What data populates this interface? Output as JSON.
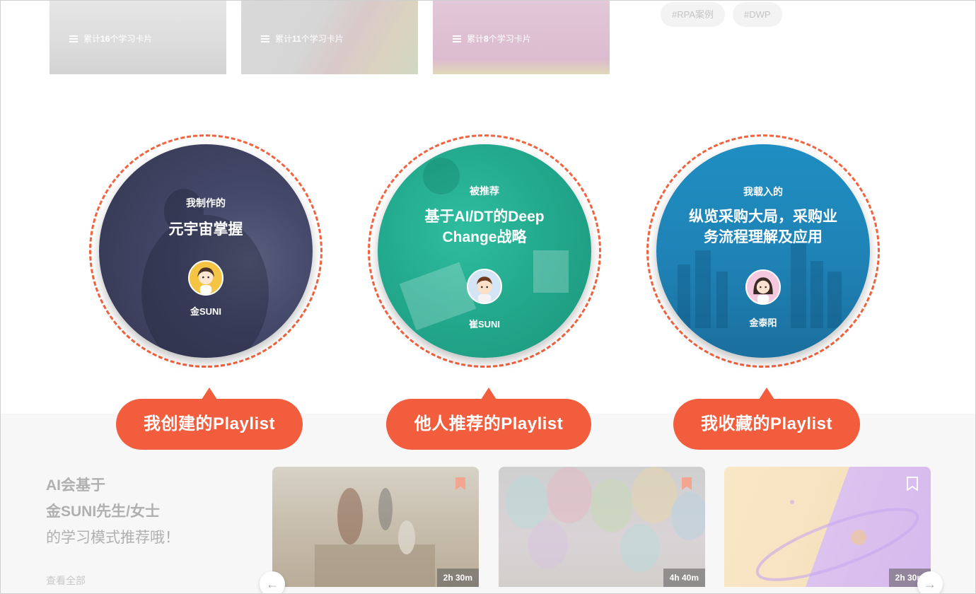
{
  "top_cards": [
    {
      "prefix": "累计",
      "count": "16",
      "suffix": "个学习卡片"
    },
    {
      "prefix": "累计",
      "count": "11",
      "suffix": "个学习卡片"
    },
    {
      "prefix": "累计",
      "count": "8",
      "suffix": "个学习卡片"
    }
  ],
  "tags": [
    "#RPA案例",
    "#DWP"
  ],
  "circles": [
    {
      "kicker": "我制作的",
      "title": "元宇宙掌握",
      "owner": "金SUNI"
    },
    {
      "kicker": "被推荐",
      "title_line1": "基于AI/DT的Deep",
      "title_line2": "Change战略",
      "owner": "崔SUNI"
    },
    {
      "kicker": "我载入的",
      "title_line1": "纵览采购大局，采购业",
      "title_line2": "务流程理解及应用",
      "owner": "金泰阳"
    }
  ],
  "pills": [
    "我创建的Playlist",
    "他人推荐的Playlist",
    "我收藏的Playlist"
  ],
  "recommendation": {
    "line1": "AI会基于",
    "line2": "金SUNI先生/女士",
    "line3": "的学习模式推荐哦！",
    "view_all": "查看全部"
  },
  "courses": [
    {
      "duration": "2h 30m"
    },
    {
      "duration": "4h 40m"
    },
    {
      "duration": "2h 30m"
    }
  ],
  "colors": {
    "accent": "#f25d3d",
    "teal": "#21a98e",
    "blue": "#1f85b8",
    "dark": "#3a3d55"
  }
}
